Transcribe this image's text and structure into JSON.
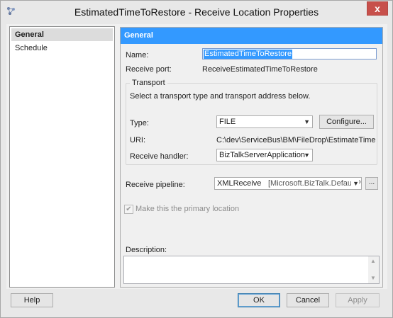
{
  "window": {
    "title": "EstimatedTimeToRestore - Receive Location Properties",
    "close_glyph": "x"
  },
  "nav": {
    "items": [
      {
        "label": "General",
        "selected": true
      },
      {
        "label": "Schedule",
        "selected": false
      }
    ]
  },
  "general": {
    "header": "General",
    "name_label": "Name:",
    "name_value": "EstimatedTimeToRestore",
    "receive_port_label": "Receive port:",
    "receive_port_value": "ReceiveEstimatedTimeToRestore",
    "transport": {
      "group_title": "Transport",
      "instruction": "Select a transport type and transport address below.",
      "type_label": "Type:",
      "type_value": "FILE",
      "configure_label": "Configure...",
      "uri_label": "URI:",
      "uri_value": "C:\\dev\\ServiceBus\\BM\\FileDrop\\EstimateTimeToResto",
      "handler_label": "Receive handler:",
      "handler_value": "BizTalkServerApplication"
    },
    "pipeline_label": "Receive pipeline:",
    "pipeline_value": "XMLReceive",
    "pipeline_assembly": "[Microsoft.BizTalk.DefaultPip",
    "pipeline_ellipsis": "...",
    "primary_location_label": "Make this the primary location",
    "primary_location_checked": true,
    "description_label": "Description:",
    "description_value": ""
  },
  "footer": {
    "help_label": "Help",
    "ok_label": "OK",
    "cancel_label": "Cancel",
    "apply_label": "Apply"
  },
  "colors": {
    "header_blue": "#3399ff",
    "close_red": "#c7504b",
    "selection_blue": "#3399ff"
  },
  "icons": [
    "biztalk-app-icon",
    "dropdown-arrow-icon",
    "checkmark-icon",
    "scroll-up-icon",
    "scroll-down-icon"
  ]
}
